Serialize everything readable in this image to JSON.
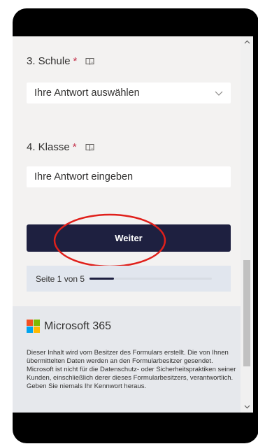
{
  "questions": [
    {
      "number_label": "3. Schule",
      "required_marker": "*",
      "type": "dropdown",
      "placeholder": "Ihre Antwort auswählen"
    },
    {
      "number_label": "4. Klasse",
      "required_marker": "*",
      "type": "text",
      "placeholder": "Ihre Antwort eingeben"
    }
  ],
  "next_button_label": "Weiter",
  "progress": {
    "label": "Seite 1 von 5",
    "current": 1,
    "total": 5
  },
  "footer": {
    "brand_name": "Microsoft 365",
    "disclaimer": "Dieser Inhalt wird vom Besitzer des Formulars erstellt. Die von Ihnen übermittelten Daten werden an den Formularbesitzer gesendet. Microsoft ist nicht für die Datenschutz- oder Sicherheitspraktiken seiner Kunden, einschließlich derer dieses Formularbesitzers, verantwortlich. Geben Sie niemals Ihr Kennwort heraus."
  },
  "colors": {
    "accent": "#1e2040",
    "required": "#c4314b",
    "annotation": "#e0201b",
    "logo_red": "#f25022",
    "logo_green": "#7fba00",
    "logo_blue": "#00a4ef",
    "logo_yellow": "#ffb900"
  }
}
